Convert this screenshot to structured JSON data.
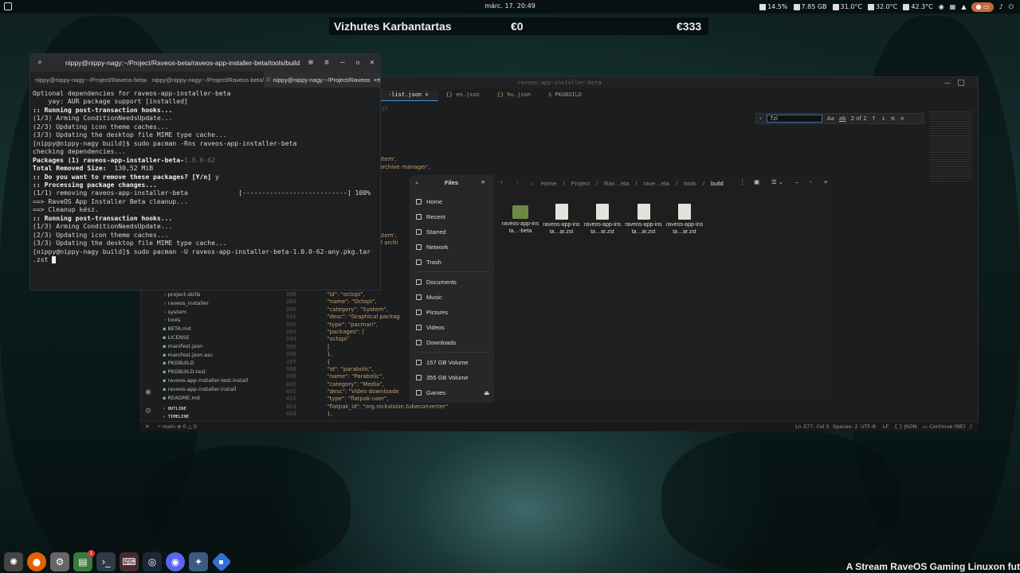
{
  "topbar": {
    "clock": "márc. 17.  20:49",
    "cpu": "14.5%",
    "mem": "7.85 GB",
    "temp1": "31.0°C",
    "temp2": "32.0°C",
    "temp3": "42.3°C"
  },
  "banner": {
    "title": "Vizhutes Karbantartas",
    "left_amount": "€0",
    "right_amount": "€333"
  },
  "terminal": {
    "title": "nippy@nippy-nagy:~/Project/Raveos-beta/raveos-app-installer-beta/tools/build",
    "tabs": [
      "nippy@nippy-nagy:~/Project/Raveos-beta/raveos-app-installer-beta/tools/build",
      "nippy@nippy-nagy:~/Project/Raveos-beta/raveos-app-installer-beta/tools/build",
      "nippy@nippy-nagy:~/Project/Raveos-beta/raveos-app-installer-beta/tools/build"
    ],
    "lines": [
      {
        "text": "Optional dependencies for raveos-app-installer-beta"
      },
      {
        "text": "    yay: AUR package support [installed]"
      },
      {
        "text": ":: Running post-transaction hooks...",
        "bold": true
      },
      {
        "text": "(1/3) Arming ConditionNeedsUpdate..."
      },
      {
        "text": "(2/3) Updating icon theme caches..."
      },
      {
        "text": "(3/3) Updating the desktop file MIME type cache..."
      },
      {
        "text": "[nippy@nippy-nagy build]$ sudo pacman -Rns raveos-app-installer-beta"
      },
      {
        "text": "checking dependencies..."
      },
      {
        "text": ""
      },
      {
        "text": "Packages (1) raveos-app-installer-beta-",
        "bold": true,
        "dim": "1.0.0-62"
      },
      {
        "text": ""
      },
      {
        "text": "Total Removed Size:  ",
        "bold": true,
        "rest": "130,52 MiB"
      },
      {
        "text": ""
      },
      {
        "text": ":: Do you want to remove these packages? [Y/n] ",
        "bold": true,
        "rest": "y"
      },
      {
        "text": ":: Processing package changes...",
        "bold": true
      },
      {
        "text": "(1/1) removing raveos-app-installer-beta             [---------------------------] 100%"
      },
      {
        "text": "==> RaveOS App Installer Beta cleanup..."
      },
      {
        "text": "==> Cleanup kész."
      },
      {
        "text": ":: Running post-transaction hooks...",
        "bold": true
      },
      {
        "text": "(1/3) Arming ConditionNeedsUpdate..."
      },
      {
        "text": "(2/3) Updating icon theme caches..."
      },
      {
        "text": "(3/3) Updating the desktop file MIME type cache..."
      },
      {
        "text": "[nippy@nippy-nagy build]$ sudo pacman -U raveos-app-installer-beta-1.0.0-62-any.pkg.tar"
      },
      {
        "text": ".zst ",
        "cursor": true
      }
    ]
  },
  "vscode": {
    "title": "raveos-app-installer-beta",
    "tabs": [
      "-list.json",
      "en.json",
      "hu.json",
      "PKGBUILD"
    ],
    "tab_line": "37",
    "find": {
      "value": "7zl",
      "case": "Aa",
      "word": "ab",
      "result": "2 of 2"
    },
    "bg_lines": [
      "stem',",
      "archive manager',",
      "stem',",
      "ll archi"
    ],
    "sidebar": [
      "project-skills",
      "raveos_installer",
      "system",
      "tools",
      "BETA.md",
      "LICENSE",
      "manifest.json",
      "manifest.json.asc",
      "PKGBUILD",
      "PKGBUILD-test",
      "raveos-app-installer-test.install",
      "raveos-app-installer.install",
      "README.md"
    ],
    "outline": "OUTLINE",
    "timeline": "TIMELINE",
    "code": [
      {
        "n": "388",
        "c": "    \"id\": \"octopi\","
      },
      {
        "n": "389",
        "c": "    \"name\": \"Octopi\","
      },
      {
        "n": "390",
        "c": "    \"category\": \"System\","
      },
      {
        "n": "391",
        "c": "    \"desc\": \"Graphical packag"
      },
      {
        "n": "392",
        "c": "    \"type\": \"pacman\","
      },
      {
        "n": "393",
        "c": "    \"packages\": ["
      },
      {
        "n": "394",
        "c": "      \"octopi\""
      },
      {
        "n": "395",
        "c": "    ]"
      },
      {
        "n": "396",
        "c": "  },"
      },
      {
        "n": "397",
        "c": "  {"
      },
      {
        "n": "398",
        "c": "    \"id\": \"parabolic\","
      },
      {
        "n": "399",
        "c": "    \"name\": \"Parabolic\","
      },
      {
        "n": "400",
        "c": "    \"category\": \"Media\","
      },
      {
        "n": "401",
        "c": "    \"desc\": \"Video downloade"
      },
      {
        "n": "402",
        "c": "    \"type\": \"flatpak-user\","
      },
      {
        "n": "403",
        "c": "    \"flatpak_id\": \"org.nickvision.tubeconverter\""
      },
      {
        "n": "404",
        "c": "  },"
      }
    ],
    "status": {
      "branch": "main",
      "errors": "0",
      "warnings": "0",
      "position": "Ln 377, Col 5",
      "spaces": "Spaces: 2",
      "encoding": "UTF-8",
      "eol": "LF",
      "lang": "{ } JSON",
      "continue": "Continue (NE)"
    }
  },
  "files": {
    "title": "Files",
    "places": [
      "Home",
      "Recent",
      "Starred",
      "Network",
      "Trash"
    ],
    "dirs": [
      "Documents",
      "Music",
      "Pictures",
      "Videos",
      "Downloads"
    ],
    "volumes": [
      "157 GB Volume",
      "355 GB Volume",
      "Games"
    ],
    "path": [
      "Home",
      "Project",
      "Rav…eta",
      "rave…eta",
      "tools",
      "build"
    ],
    "items": [
      {
        "label": "raveos-app-insta…-beta",
        "type": "folder"
      },
      {
        "label": "raveos-app-insta…ar.zst",
        "type": "file"
      },
      {
        "label": "raveos-app-insta…ar.zst",
        "type": "file"
      },
      {
        "label": "raveos-app-insta…ar.zst",
        "type": "file"
      },
      {
        "label": "raveos-app-insta…ar.zst",
        "type": "file"
      }
    ]
  },
  "dock": {
    "badge": "1"
  },
  "footer": "A Stream RaveOS Gaming Linuxon fut"
}
